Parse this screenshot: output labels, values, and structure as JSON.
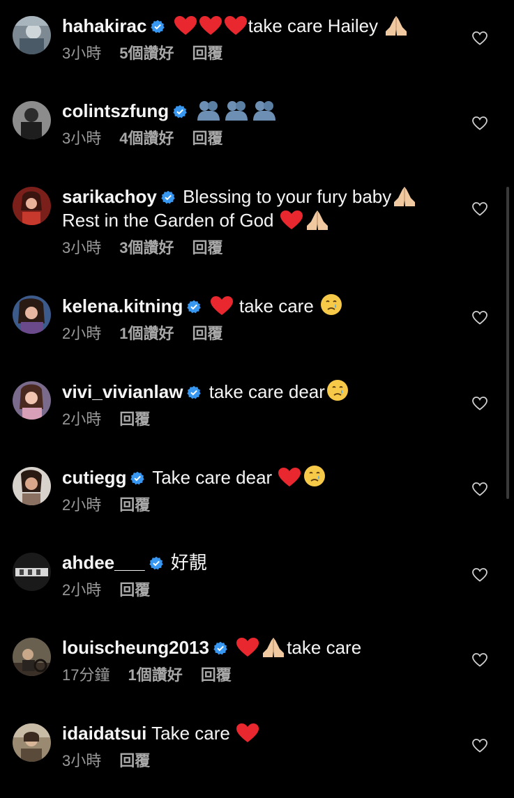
{
  "comments": [
    {
      "username": "hahakirac",
      "parts": [
        "heart",
        "heart",
        "heart",
        "text:take care Hailey ",
        "pray"
      ],
      "time": "3小時",
      "likes": "5個讚好",
      "reply": "回覆"
    },
    {
      "username": "colintszfung",
      "parts": [
        "hug",
        "hug",
        "hug"
      ],
      "time": "3小時",
      "likes": "4個讚好",
      "reply": "回覆"
    },
    {
      "username": "sarikachoy",
      "parts": [
        "text:Blessing to your fury baby",
        "pray"
      ],
      "second_line": "Rest in the Garden of God ",
      "second_line_parts": [
        "heart",
        "pray"
      ],
      "time": "3小時",
      "likes": "3個讚好",
      "reply": "回覆"
    },
    {
      "username": "kelena.kitning",
      "parts": [
        "heart",
        "text: take care ",
        "cry"
      ],
      "time": "2小時",
      "likes": "1個讚好",
      "reply": "回覆"
    },
    {
      "username": "vivi_vivianlaw",
      "parts": [
        "text:take care dear",
        "cry"
      ],
      "time": "2小時",
      "likes": "",
      "reply": "回覆"
    },
    {
      "username": "cutiegg",
      "parts": [
        "text:Take care dear ",
        "heart",
        "cry"
      ],
      "time": "2小時",
      "likes": "",
      "reply": "回覆"
    },
    {
      "username": "ahdee___",
      "parts": [
        "text:好靚"
      ],
      "time": "2小時",
      "likes": "",
      "reply": "回覆"
    },
    {
      "username": "louischeung2013",
      "parts": [
        "heart",
        "pray",
        "text:take care"
      ],
      "time": "17分鐘",
      "likes": "1個讚好",
      "reply": "回覆"
    },
    {
      "username": "idaidatsui",
      "verified": false,
      "parts": [
        "text:Take care ",
        "heart"
      ],
      "time": "3小時",
      "likes": "",
      "reply": "回覆"
    }
  ],
  "colors": {
    "background": "#000000",
    "verified": "#3897f0",
    "heart": "#e8272e",
    "meta": "#9a9a9a"
  }
}
